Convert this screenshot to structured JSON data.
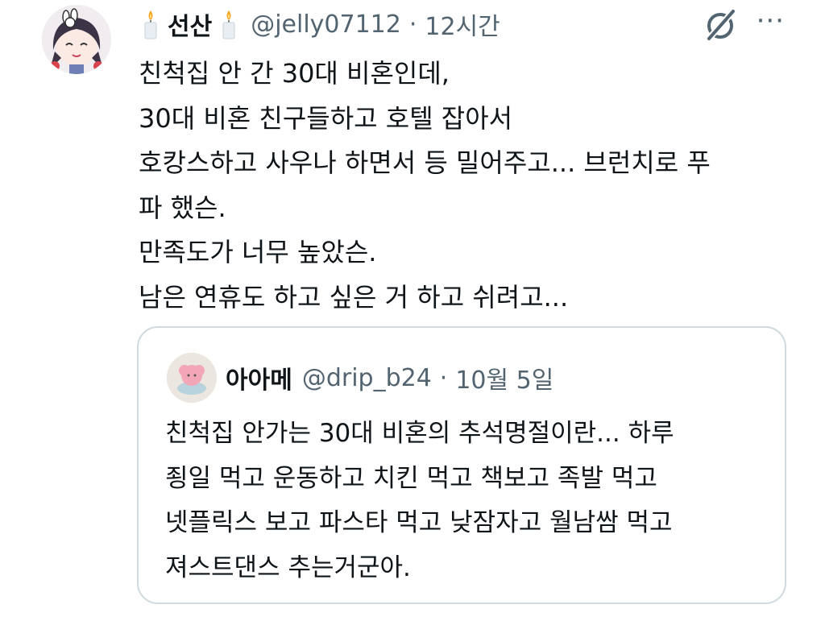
{
  "tweet": {
    "author_name": "선산",
    "author_handle": "@jelly07112",
    "separator": "·",
    "timestamp": "12시간",
    "name_emoji_icon": "candle-icon",
    "grok_icon": "grok-icon",
    "more_label": "···",
    "text_lines": [
      "친척집 안 간 30대 비혼인데,",
      "30대 비혼 친구들하고 호텔 잡아서",
      "호캉스하고 사우나 하면서 등 밀어주고... 브런치로 푸",
      "파 했슨.",
      "만족도가 너무 높았슨.",
      "남은 연휴도 하고 싶은 거 하고 쉬려고..."
    ]
  },
  "quoted": {
    "author_name": "아아메",
    "author_handle": "@drip_b24",
    "separator": "·",
    "timestamp": "10월 5일",
    "text_lines": [
      "친척집 안가는 30대 비혼의 추석명절이란... 하루",
      "죙일 먹고 운동하고 치킨 먹고 책보고 족발 먹고",
      "넷플릭스 보고 파스타 먹고 낮잠자고 월남쌈 먹고",
      "져스트댄스 추는거군아."
    ]
  },
  "colors": {
    "text": "#0f1419",
    "secondary": "#536471",
    "border": "#cfd9de"
  }
}
